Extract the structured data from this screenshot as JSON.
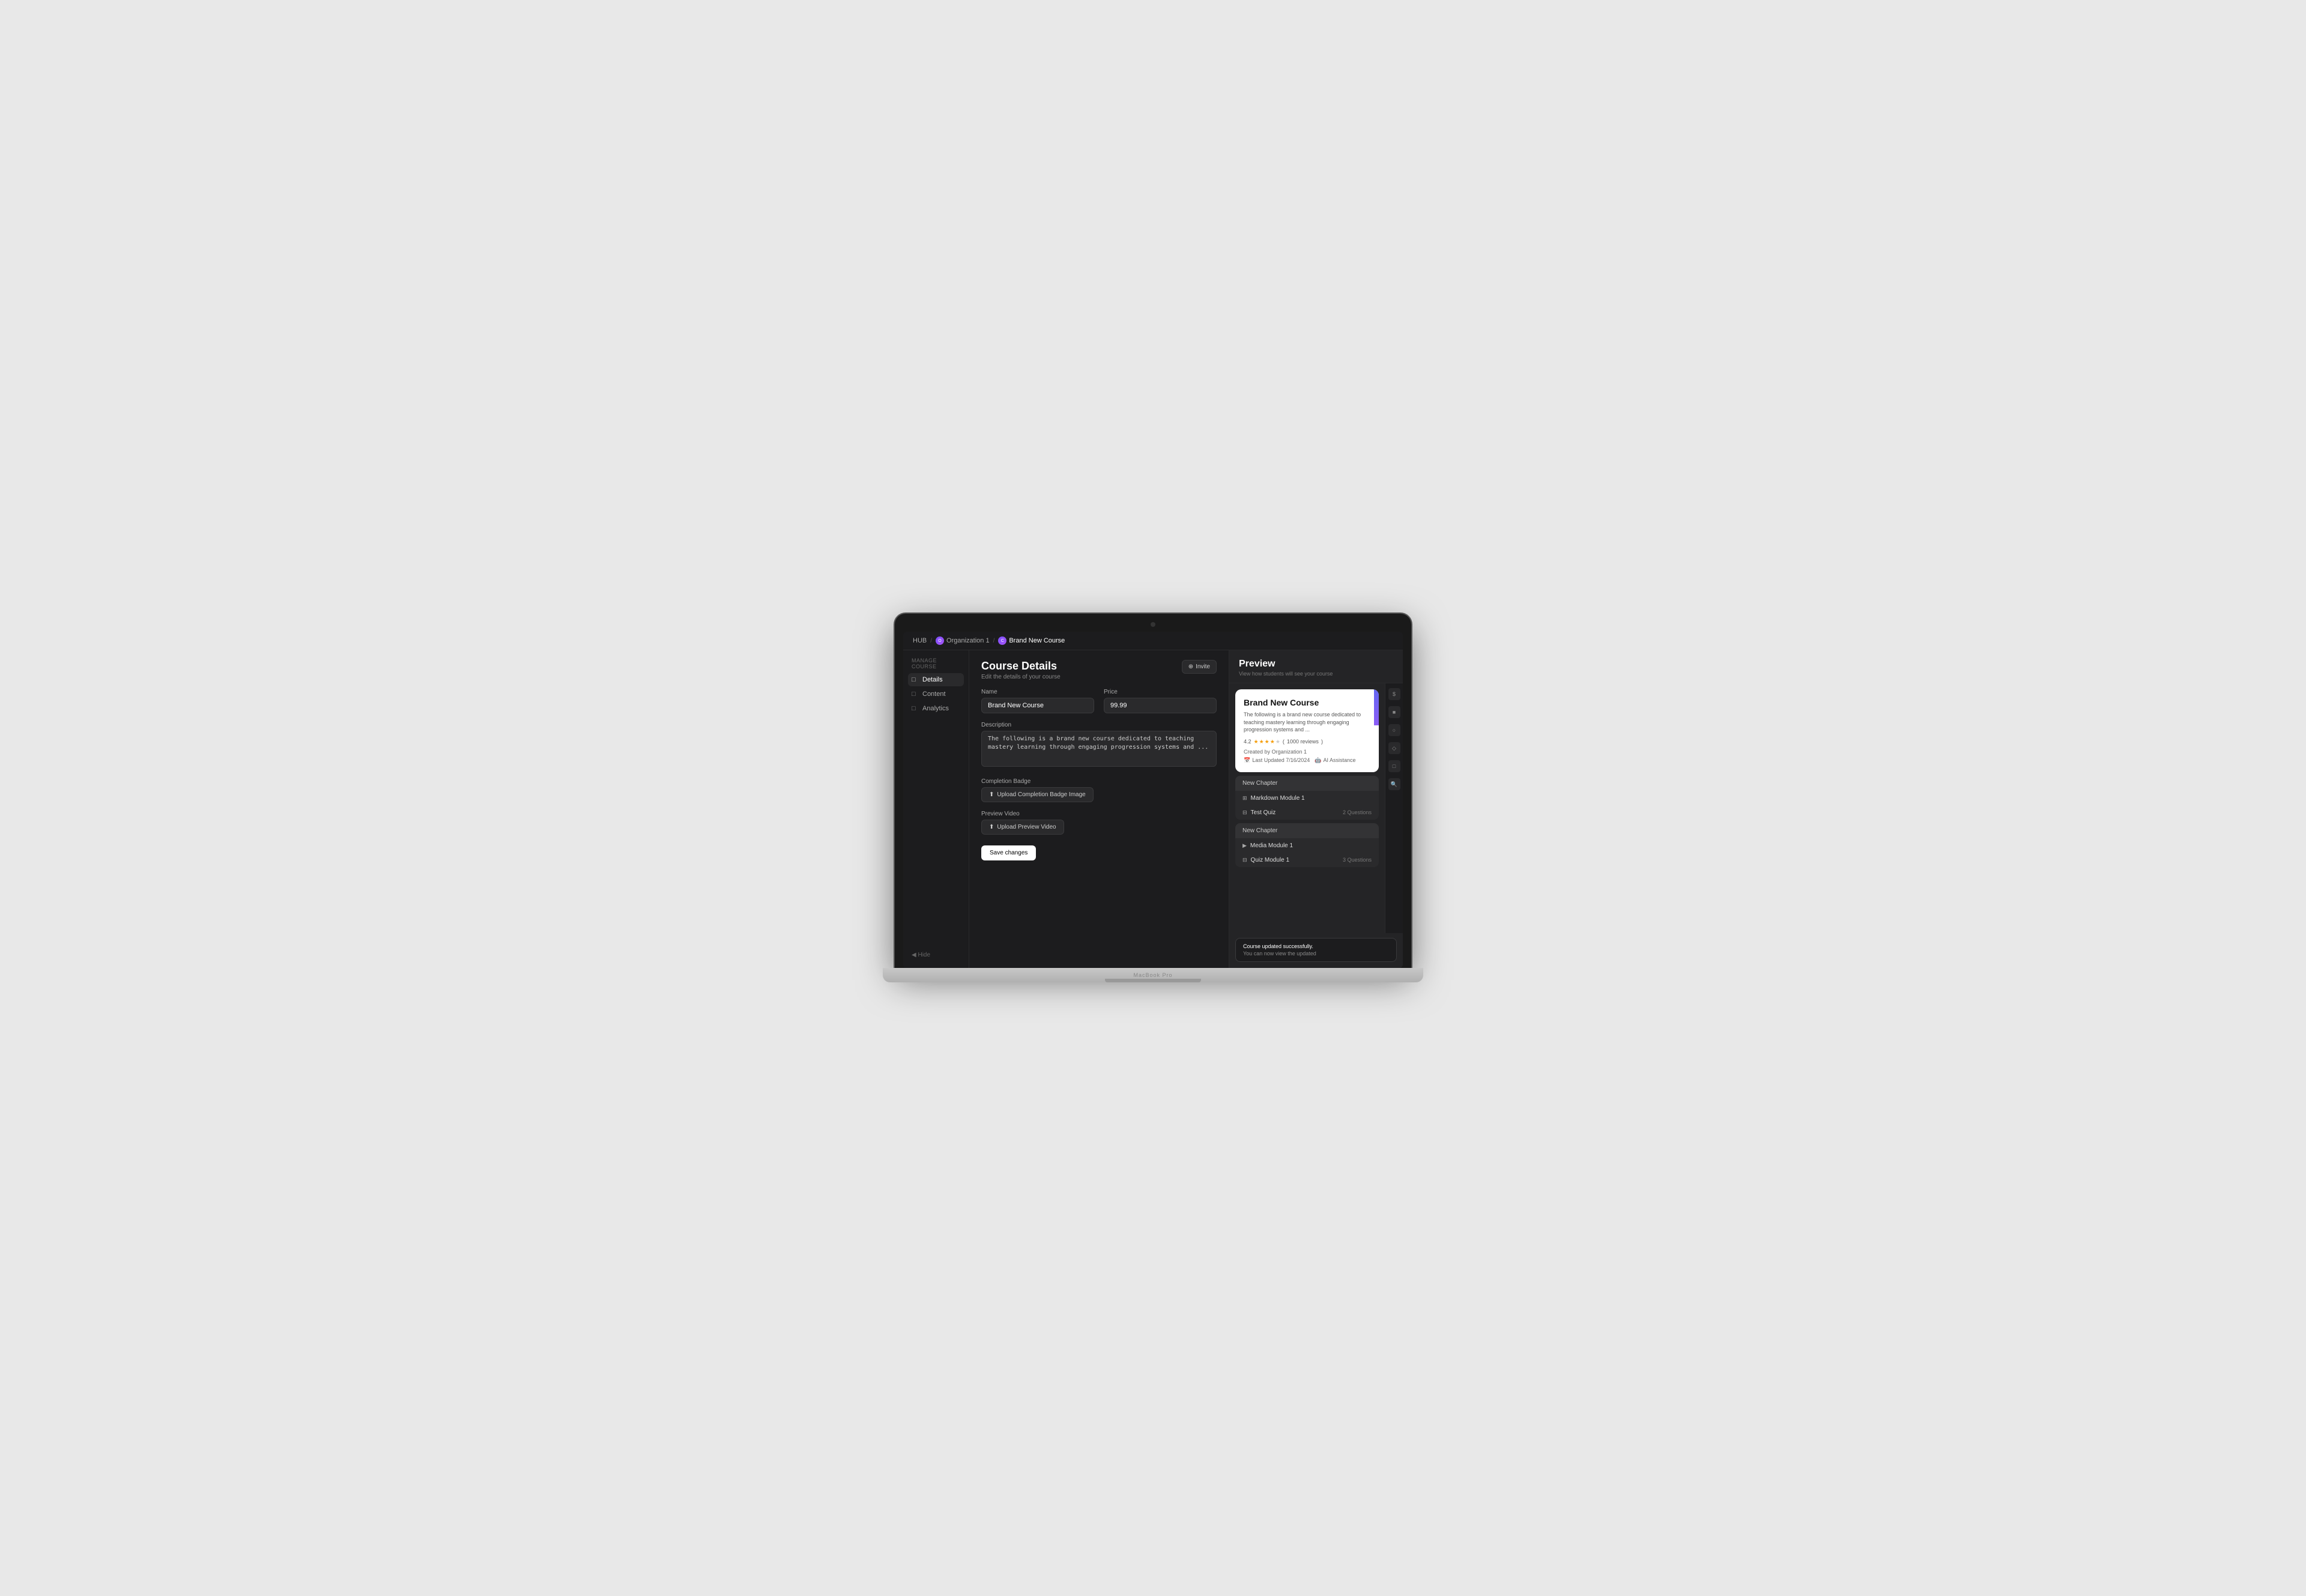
{
  "laptop": {
    "label": "MacBook Pro"
  },
  "breadcrumb": {
    "hub": "HUB",
    "org": "Organization 1",
    "course": "Brand New Course"
  },
  "sidebar": {
    "manage_label": "Manage Course",
    "items": [
      {
        "id": "details",
        "label": "Details",
        "icon": "□",
        "active": true
      },
      {
        "id": "content",
        "label": "Content",
        "icon": "□",
        "active": false
      },
      {
        "id": "analytics",
        "label": "Analytics",
        "icon": "□",
        "active": false
      }
    ],
    "hide_label": "◀ Hide"
  },
  "form": {
    "title": "Course Details",
    "subtitle": "Edit the details of your course",
    "invite_label": "Invite",
    "name_label": "Name",
    "name_value": "Brand New Course",
    "price_label": "Price",
    "price_value": "99.99",
    "description_label": "Description",
    "description_value": "The following is a brand new course dedicated to teaching mastery learning through engaging progression systems and ...",
    "completion_badge_label": "Completion Badge",
    "upload_badge_label": "Upload Completion Badge Image",
    "preview_video_label": "Preview Video",
    "upload_video_label": "Upload Preview Video",
    "save_label": "Save changes"
  },
  "preview": {
    "title": "Preview",
    "subtitle": "View how students will see your course",
    "card": {
      "title": "Brand New Course",
      "description": "The following is a brand new course dedicated to teaching mastery learning through engaging progression systems and ...",
      "rating": "4.2",
      "reviews": "1000 reviews",
      "creator": "Created by Organization 1",
      "last_updated": "Last Updated 7/16/2024",
      "ai_label": "AI Assistance"
    },
    "chapters": [
      {
        "title": "New Chapter",
        "items": [
          {
            "icon": "⊞",
            "name": "Markdown Module 1",
            "meta": ""
          },
          {
            "icon": "⊟",
            "name": "Test Quiz",
            "meta": "2 Questions"
          }
        ]
      },
      {
        "title": "New Chapter",
        "items": [
          {
            "icon": "▶",
            "name": "Media Module 1",
            "meta": ""
          },
          {
            "icon": "⊟",
            "name": "Quiz Module 1",
            "meta": "3 Questions"
          }
        ]
      }
    ]
  },
  "toast": {
    "title": "Course updated successfully.",
    "message": "You can now view the updated"
  },
  "right_icons": [
    "$",
    "■",
    "○",
    "◇",
    "□",
    "○"
  ]
}
